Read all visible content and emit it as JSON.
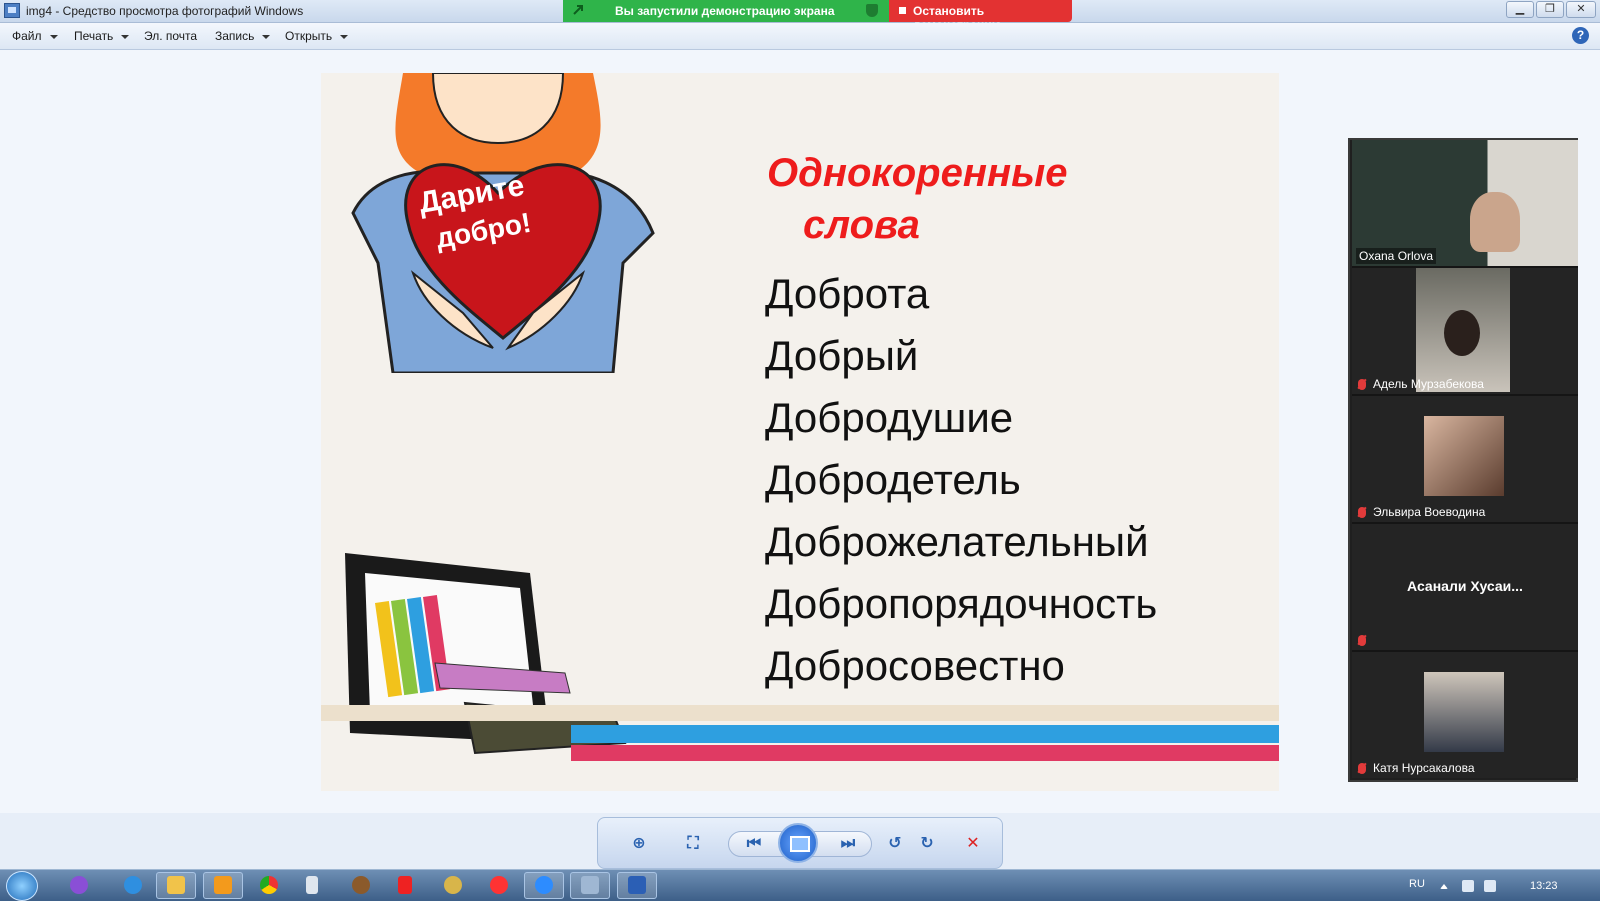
{
  "window": {
    "title": "img4 - Средство просмотра фотографий Windows"
  },
  "share": {
    "banner": "Вы запустили демонстрацию экрана",
    "stop_label": "Остановить демонстрацию"
  },
  "menu": {
    "items": [
      "Файл",
      "Печать",
      "Эл. почта",
      "Запись",
      "Открыть"
    ],
    "help": "?"
  },
  "slide": {
    "title_line1": "Однокоренные",
    "title_line2": "слова",
    "words": [
      "Доброта",
      "Добрый",
      "Добродушие",
      "Добродетель",
      "Доброжелательный",
      "Добропорядочность",
      "Добросовестно"
    ],
    "heart_text_1": "Дарите",
    "heart_text_2": "добро!"
  },
  "participants": [
    {
      "name": "Oxana Orlova",
      "muted": false
    },
    {
      "name": "Адель Мурзабекова",
      "muted": true
    },
    {
      "name": "Эльвира Воеводина",
      "muted": true
    },
    {
      "name": "Асанали  Хусаи...",
      "muted": true
    },
    {
      "name": "Катя Нурсакалова",
      "muted": true
    }
  ],
  "taskbar": {
    "lang": "RU",
    "time": "13:23"
  },
  "colors": {
    "share_green": "#2fb44a",
    "stop_red": "#e33232",
    "title_red": "#ee1c1c"
  }
}
